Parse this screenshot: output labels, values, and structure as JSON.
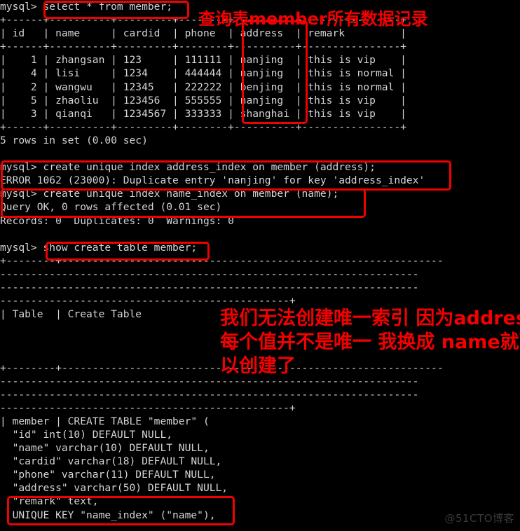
{
  "terminal": {
    "prompt": "mysql>",
    "lines": [
      {
        "id": "l01",
        "text": "mysql> select * from member;"
      },
      {
        "id": "l02",
        "text": "+------+----------+---------+--------+----------+----------------+"
      },
      {
        "id": "l03",
        "text": "| id   | name     | cardid  | phone  | address  | remark         |"
      },
      {
        "id": "l04",
        "text": "+------+----------+---------+--------+----------+----------------+"
      },
      {
        "id": "l05",
        "text": "|    1 | zhangsan | 123     | 111111 | nanjing  | this is vip    |"
      },
      {
        "id": "l06",
        "text": "|    4 | lisi     | 1234    | 444444 | nanjing  | this is normal |"
      },
      {
        "id": "l07",
        "text": "|    2 | wangwu   | 12345   | 222222 | benjing  | this is normal |"
      },
      {
        "id": "l08",
        "text": "|    5 | zhaoliu  | 123456  | 555555 | nanjing  | this is vip    |"
      },
      {
        "id": "l09",
        "text": "|    3 | qianqi   | 1234567 | 333333 | shanghai | this is vip    |"
      },
      {
        "id": "l10",
        "text": "+------+----------+---------+--------+----------+----------------+"
      },
      {
        "id": "l11",
        "text": "5 rows in set (0.00 sec)"
      },
      {
        "id": "l12",
        "text": ""
      },
      {
        "id": "l13",
        "text": "mysql> create unique index address_index on member (address);"
      },
      {
        "id": "l14",
        "text": "ERROR 1062 (23000): Duplicate entry 'nanjing' for key 'address_index'"
      },
      {
        "id": "l15",
        "text": "mysql> create unique index name_index on member (name);"
      },
      {
        "id": "l16",
        "text": "Query OK, 0 rows affected (0.01 sec)"
      },
      {
        "id": "l17",
        "text": "Records: 0  Duplicates: 0  Warnings: 0"
      },
      {
        "id": "l18",
        "text": ""
      },
      {
        "id": "l19",
        "text": "mysql> show create table member;"
      },
      {
        "id": "l20",
        "text": "+--------+--------------------------------------------------------------"
      },
      {
        "id": "l21",
        "text": "--------------------------------------------------------------------"
      },
      {
        "id": "l22",
        "text": "--------------------------------------------------------------------"
      },
      {
        "id": "l23",
        "text": "-----------------------------------------------+"
      },
      {
        "id": "l24",
        "text": "| Table  | Create Table"
      },
      {
        "id": "l25",
        "text": ""
      },
      {
        "id": "l26",
        "text": ""
      },
      {
        "id": "l27",
        "text": ""
      },
      {
        "id": "l28",
        "text": "+--------+--------------------------------------------------------------"
      },
      {
        "id": "l29",
        "text": "--------------------------------------------------------------------"
      },
      {
        "id": "l30",
        "text": "--------------------------------------------------------------------"
      },
      {
        "id": "l31",
        "text": "-----------------------------------------------+"
      },
      {
        "id": "l32",
        "text": "| member | CREATE TABLE \"member\" ("
      },
      {
        "id": "l33",
        "text": "  \"id\" int(10) DEFAULT NULL,"
      },
      {
        "id": "l34",
        "text": "  \"name\" varchar(10) DEFAULT NULL,"
      },
      {
        "id": "l35",
        "text": "  \"cardid\" varchar(18) DEFAULT NULL,"
      },
      {
        "id": "l36",
        "text": "  \"phone\" varchar(11) DEFAULT NULL,"
      },
      {
        "id": "l37",
        "text": "  \"address\" varchar(50) DEFAULT NULL,"
      },
      {
        "id": "l38",
        "text": "  \"remark\" text,"
      },
      {
        "id": "l39",
        "text": "  UNIQUE KEY \"name_index\" (\"name\"),"
      }
    ]
  },
  "query_result": {
    "columns": [
      "id",
      "name",
      "cardid",
      "phone",
      "address",
      "remark"
    ],
    "rows": [
      [
        "1",
        "zhangsan",
        "123",
        "111111",
        "nanjing",
        "this is vip"
      ],
      [
        "4",
        "lisi",
        "1234",
        "444444",
        "nanjing",
        "this is normal"
      ],
      [
        "2",
        "wangwu",
        "12345",
        "222222",
        "benjing",
        "this is normal"
      ],
      [
        "5",
        "zhaoliu",
        "123456",
        "555555",
        "nanjing",
        "this is vip"
      ],
      [
        "3",
        "qianqi",
        "1234567",
        "333333",
        "shanghai",
        "this is vip"
      ]
    ],
    "row_count_text": "5 rows in set (0.00 sec)"
  },
  "annotations": {
    "note_top": "查询表member所有数据记录",
    "note_mid_line1": "我们无法创建唯一索引 因为address",
    "note_mid_line2": "每个值并不是唯一 我换成 name就可",
    "note_mid_line3": "以创建了"
  },
  "highlight_boxes": [
    {
      "name": "select-statement-box"
    },
    {
      "name": "address-column-box"
    },
    {
      "name": "create-address-index-box"
    },
    {
      "name": "create-name-index-box"
    },
    {
      "name": "show-create-table-box"
    },
    {
      "name": "unique-key-box"
    }
  ],
  "watermark": "@51CTO博客",
  "colors": {
    "background": "#000000",
    "foreground": "#d4d4d4",
    "annotation_red": "#f40000",
    "watermark": "#3a3a3a"
  }
}
